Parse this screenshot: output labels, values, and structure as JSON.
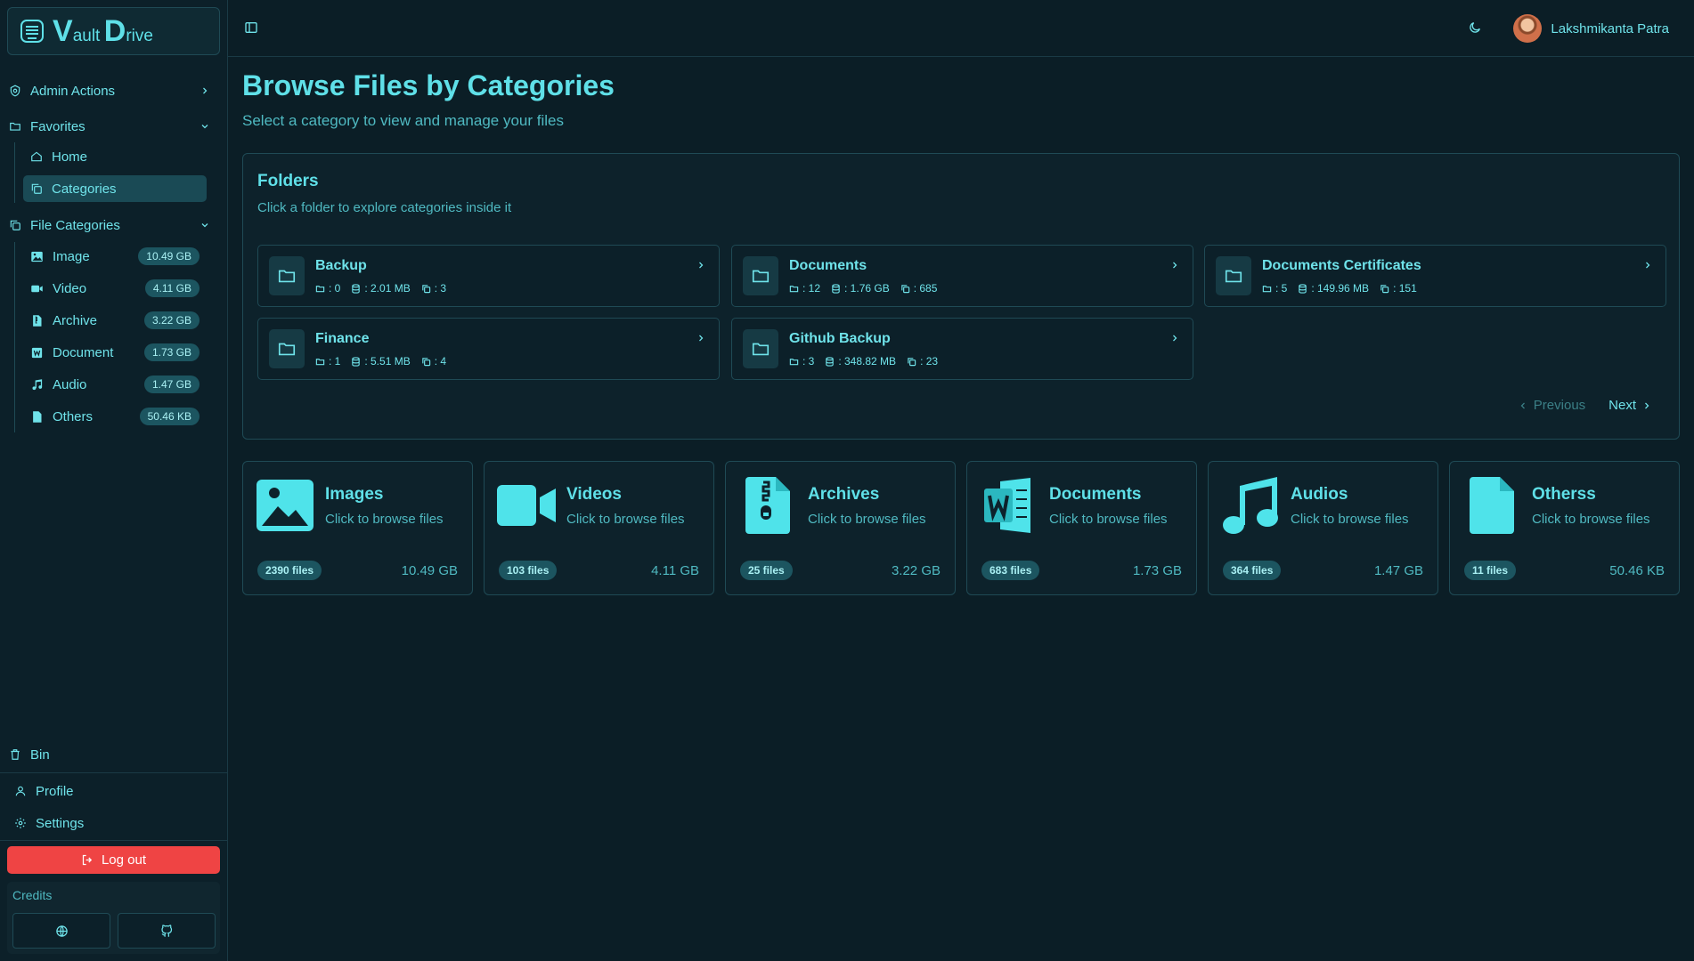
{
  "brand": {
    "v": "V",
    "ault": "ault",
    "d": "D",
    "rive": "rive"
  },
  "sidebar": {
    "admin_actions": "Admin Actions",
    "favorites": {
      "label": "Favorites",
      "items": [
        {
          "label": "Home"
        },
        {
          "label": "Categories"
        }
      ]
    },
    "file_categories": {
      "label": "File Categories",
      "items": [
        {
          "label": "Image",
          "size": "10.49 GB"
        },
        {
          "label": "Video",
          "size": "4.11 GB"
        },
        {
          "label": "Archive",
          "size": "3.22 GB"
        },
        {
          "label": "Document",
          "size": "1.73 GB"
        },
        {
          "label": "Audio",
          "size": "1.47 GB"
        },
        {
          "label": "Others",
          "size": "50.46 KB"
        }
      ]
    },
    "bin": "Bin",
    "profile": "Profile",
    "settings": "Settings",
    "logout": "Log out",
    "credits": "Credits"
  },
  "header": {
    "user_name": "Lakshmikanta Patra"
  },
  "main": {
    "title": "Browse Files by Categories",
    "subtitle": "Select a category to view and manage your files",
    "folders": {
      "title": "Folders",
      "subtitle": "Click a folder to explore categories inside it",
      "items": [
        {
          "name": "Backup",
          "folders": ": 0",
          "size": ": 2.01 MB",
          "files": ": 3"
        },
        {
          "name": "Documents",
          "folders": ": 12",
          "size": ": 1.76 GB",
          "files": ": 685"
        },
        {
          "name": "Documents Certificates",
          "folders": ": 5",
          "size": ": 149.96 MB",
          "files": ": 151"
        },
        {
          "name": "Finance",
          "folders": ": 1",
          "size": ": 5.51 MB",
          "files": ": 4"
        },
        {
          "name": "Github Backup",
          "folders": ": 3",
          "size": ": 348.82 MB",
          "files": ": 23"
        }
      ],
      "previous": "Previous",
      "next": "Next"
    },
    "categories": [
      {
        "title": "Images",
        "sub": "Click to browse files",
        "count": "2390 files",
        "size": "10.49 GB",
        "icon": "image-icon"
      },
      {
        "title": "Videos",
        "sub": "Click to browse files",
        "count": "103 files",
        "size": "4.11 GB",
        "icon": "video-icon"
      },
      {
        "title": "Archives",
        "sub": "Click to browse files",
        "count": "25 files",
        "size": "3.22 GB",
        "icon": "archive-icon"
      },
      {
        "title": "Documents",
        "sub": "Click to browse files",
        "count": "683 files",
        "size": "1.73 GB",
        "icon": "word-document-icon"
      },
      {
        "title": "Audios",
        "sub": "Click to browse files",
        "count": "364 files",
        "size": "1.47 GB",
        "icon": "music-icon"
      },
      {
        "title": "Otherss",
        "sub": "Click to browse files",
        "count": "11 files",
        "size": "50.46 KB",
        "icon": "file-icon"
      }
    ]
  },
  "colors": {
    "background": "#0b1e26",
    "accent": "#5fe0e8",
    "logout": "#ef4444",
    "badge": "#1c5560"
  }
}
